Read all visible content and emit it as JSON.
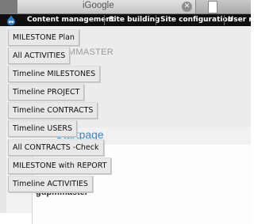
{
  "browser": {
    "tab_title": "iGoogle",
    "close_glyph": "✕"
  },
  "toolbar": {
    "items": [
      "Content management",
      "Site building",
      "Site configuration",
      "User m"
    ]
  },
  "page": {
    "site_name": "DEMO-GDPMMASTER",
    "heading": "Startpage",
    "user": "gdpmmaster"
  },
  "menu": {
    "items": [
      "MILESTONE Plan",
      "All ACTIVITIES",
      "Timeline MILESTONES",
      "Timeline PROJECT",
      "Timeline CONTRACTS",
      "Timeline USERS",
      "All CONTRACTS -Check",
      "MILESTONE with REPORT",
      "Timeline ACTIVITIES"
    ]
  },
  "colors": {
    "toolbar_bg": "#0f0f0f",
    "heading_blue": "#3a82c4",
    "drupal_blue": "#2a7ed3"
  }
}
